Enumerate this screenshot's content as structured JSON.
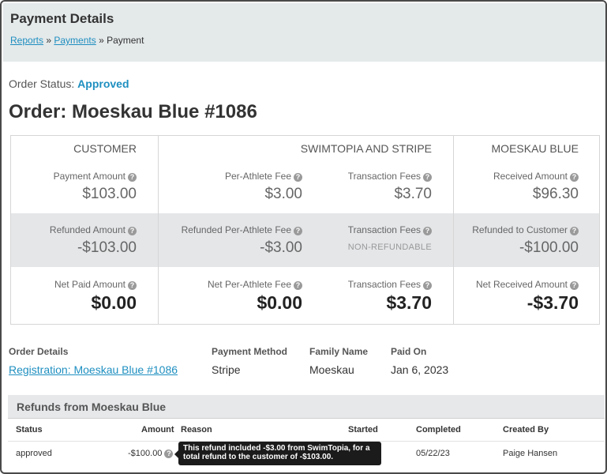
{
  "header": {
    "title": "Payment Details",
    "breadcrumb": {
      "crumb1": "Reports",
      "sep1": " » ",
      "crumb2": "Payments",
      "sep2": " » ",
      "current": "Payment"
    }
  },
  "order": {
    "status_label": "Order Status:",
    "status_value": "Approved",
    "title": "Order: Moeskau Blue #1086"
  },
  "summary": {
    "headers": {
      "customer": "CUSTOMER",
      "swimtopia": "SWIMTOPIA AND STRIPE",
      "team": "MOESKAU BLUE"
    },
    "row1": {
      "payment_amount": {
        "label": "Payment Amount",
        "value": "$103.00"
      },
      "per_athlete_fee": {
        "label": "Per-Athlete Fee",
        "value": "$3.00"
      },
      "transaction_fees": {
        "label": "Transaction Fees",
        "value": "$3.70"
      },
      "received_amount": {
        "label": "Received Amount",
        "value": "$96.30"
      }
    },
    "row2": {
      "refunded_amount": {
        "label": "Refunded Amount",
        "value": "-$103.00"
      },
      "refunded_per_athlete_fee": {
        "label": "Refunded Per-Athlete Fee",
        "value": "-$3.00"
      },
      "transaction_fees": {
        "label": "Transaction Fees",
        "value": "NON-REFUNDABLE"
      },
      "refunded_to_customer": {
        "label": "Refunded to Customer",
        "value": "-$100.00"
      }
    },
    "row3": {
      "net_paid_amount": {
        "label": "Net Paid Amount",
        "value": "$0.00"
      },
      "net_per_athlete_fee": {
        "label": "Net Per-Athlete Fee",
        "value": "$0.00"
      },
      "transaction_fees": {
        "label": "Transaction Fees",
        "value": "$3.70"
      },
      "net_received_amount": {
        "label": "Net Received Amount",
        "value": "-$3.70"
      }
    },
    "help_glyph": "?"
  },
  "details": {
    "order_details_label": "Order Details",
    "order_details_value": "Registration: Moeskau Blue #1086",
    "payment_method_label": "Payment Method",
    "payment_method_value": "Stripe",
    "family_name_label": "Family Name",
    "family_name_value": "Moeskau",
    "paid_on_label": "Paid On",
    "paid_on_value": "Jan 6, 2023"
  },
  "refunds": {
    "title": "Refunds from Moeskau Blue",
    "columns": {
      "status": "Status",
      "amount": "Amount",
      "reason": "Reason",
      "started": "Started",
      "completed": "Completed",
      "created_by": "Created By"
    },
    "rows": [
      {
        "status": "approved",
        "amount": "-$100.00",
        "completed": "05/22/23",
        "created_by": "Paige Hansen"
      }
    ],
    "tooltip": "This refund included -$3.00 from SwimTopia, for a total refund to the customer of -$103.00."
  },
  "colors": {
    "accent": "#1e8fc0",
    "header_bg": "#e4e9ea",
    "band_bg": "#e4e6e8",
    "tooltip_bg": "#1b1b1b"
  }
}
